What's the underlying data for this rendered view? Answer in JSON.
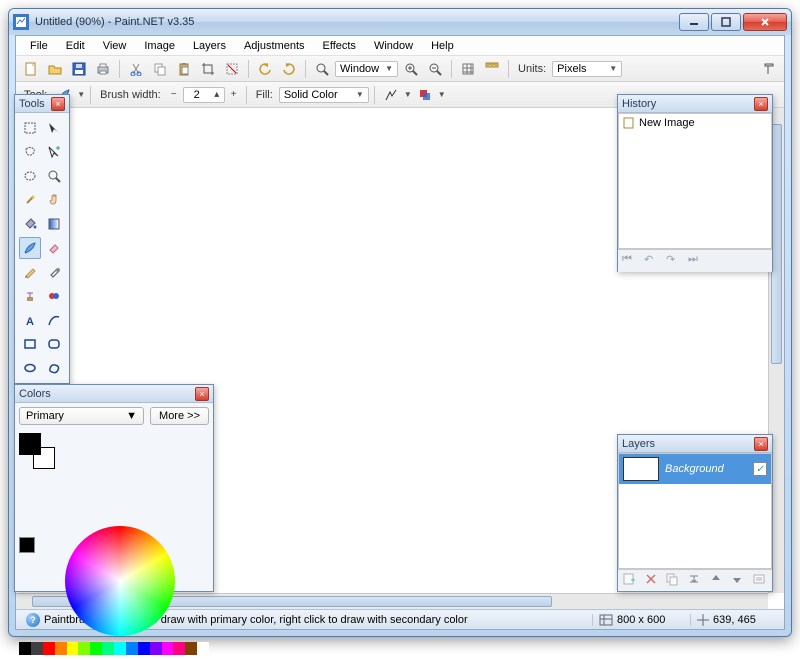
{
  "window": {
    "title": "Untitled (90%) - Paint.NET v3.35"
  },
  "menubar": [
    "File",
    "Edit",
    "View",
    "Image",
    "Layers",
    "Adjustments",
    "Effects",
    "Window",
    "Help"
  ],
  "toolbar1": {
    "zoom_mode": "Window",
    "units_label": "Units:",
    "units_value": "Pixels"
  },
  "toolbar2": {
    "tool_label": "Tool:",
    "brush_label": "Brush width:",
    "brush_value": "2",
    "fill_label": "Fill:",
    "fill_value": "Solid Color"
  },
  "panels": {
    "tools_title": "Tools",
    "history_title": "History",
    "history_items": [
      "New Image"
    ],
    "layers_title": "Layers",
    "layer_name": "Background",
    "colors_title": "Colors",
    "colors_selector": "Primary",
    "more_button": "More >>"
  },
  "status": {
    "help_text": "Paintbrush: Left click to draw with primary color, right click to draw with secondary color",
    "image_size": "800 x 600",
    "cursor_pos": "639, 465"
  },
  "palette": [
    "#000000",
    "#404040",
    "#ff0000",
    "#ff8000",
    "#ffff00",
    "#80ff00",
    "#00ff00",
    "#00ff80",
    "#00ffff",
    "#0080ff",
    "#0000ff",
    "#8000ff",
    "#ff00ff",
    "#ff0080",
    "#804000",
    "#ffffff"
  ]
}
